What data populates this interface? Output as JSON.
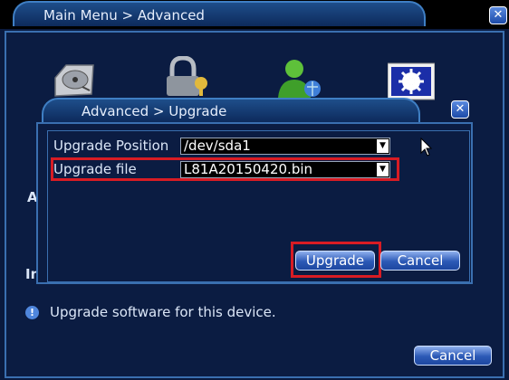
{
  "main_window": {
    "breadcrumb": "Main Menu > Advanced",
    "icons": [
      "hard-disk-icon",
      "lock-key-icon",
      "user-icon",
      "settings-gear-icon"
    ],
    "partial_label_1": "A",
    "partial_label_2": "In",
    "info_text": "Upgrade software for this device.",
    "cancel_label": "Cancel"
  },
  "dialog": {
    "breadcrumb": "Advanced > Upgrade",
    "fields": [
      {
        "label": "Upgrade Position",
        "value": "/dev/sda1"
      },
      {
        "label": "Upgrade file",
        "value": "L81A20150420.bin"
      }
    ],
    "upgrade_label": "Upgrade",
    "cancel_label": "Cancel"
  },
  "colors": {
    "highlight": "#d81c24",
    "panel": "#0b1c42",
    "button": "#2c59b6"
  }
}
